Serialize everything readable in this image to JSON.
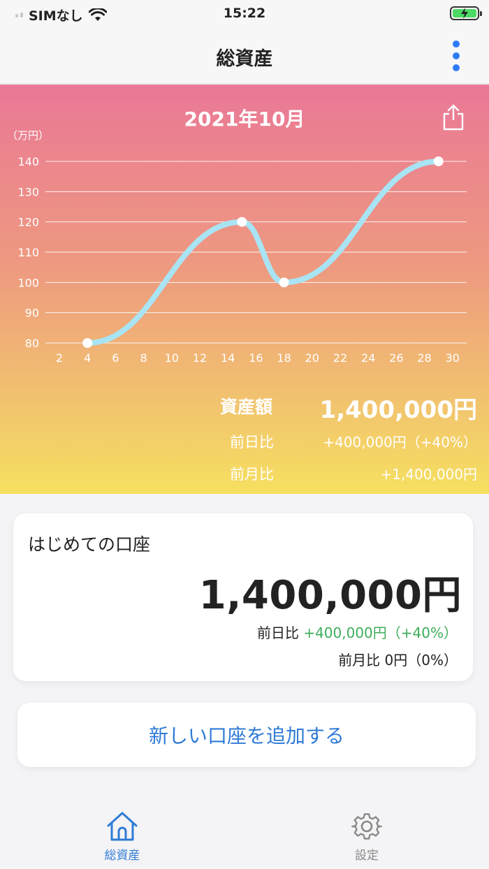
{
  "status_bar": {
    "carrier": "SIMなし",
    "time": "15:22"
  },
  "nav": {
    "title": "総資産"
  },
  "chart_data": {
    "type": "line",
    "title": "2021年10月",
    "ylabel": "（万円）",
    "ylim": [
      80,
      140
    ],
    "yticks": [
      140,
      130,
      120,
      110,
      100,
      90,
      80
    ],
    "xlim": [
      1,
      31
    ],
    "xticks": [
      2,
      4,
      6,
      8,
      10,
      12,
      14,
      16,
      18,
      20,
      22,
      24,
      26,
      28,
      30
    ],
    "points": [
      {
        "x": 4,
        "y": 80
      },
      {
        "x": 15,
        "y": 120
      },
      {
        "x": 18,
        "y": 100
      },
      {
        "x": 29,
        "y": 140
      }
    ],
    "line_color": "#a8e4f4",
    "grid": true
  },
  "summary": {
    "total_label": "資産額",
    "total_value": "1,400,000円",
    "daily_label": "前日比",
    "daily_value": "+400,000円（+40%）",
    "monthly_label": "前月比",
    "monthly_value": "+1,400,000円"
  },
  "account": {
    "name": "はじめての口座",
    "amount": "1,400,000円",
    "daily_label": "前日比",
    "daily_value": "+400,000円（+40%）",
    "monthly_label": "前月比",
    "monthly_value": "0円（0%）"
  },
  "add_account_label": "新しい口座を追加する",
  "tabs": [
    {
      "label": "総資産",
      "icon": "home-icon",
      "active": true
    },
    {
      "label": "設定",
      "icon": "gear-icon",
      "active": false
    }
  ],
  "colors": {
    "accent": "#2f7bd6",
    "positive": "#3dae5a"
  }
}
